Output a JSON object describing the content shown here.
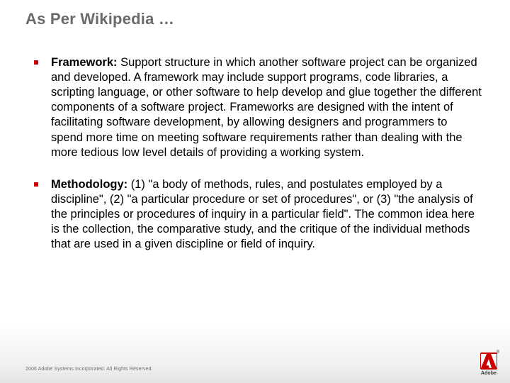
{
  "title": "As Per Wikipedia …",
  "bullets": [
    {
      "term": "Framework:",
      "body": " Support structure in which another software project can be organized and developed. A framework may include support programs, code libraries, a scripting language, or other software to help develop and glue together the different components of a software project. Frameworks are designed with the intent of facilitating software development, by allowing designers and programmers to spend more time on meeting software requirements rather than dealing with the more tedious low level details of providing a working system."
    },
    {
      "term": "Methodology:",
      "body": " (1) \"a body of methods, rules, and postulates employed by a discipline\", (2) \"a particular procedure or set of procedures\", or (3) \"the analysis of the principles or procedures of inquiry in a particular field\". The common idea here is the collection, the comparative study, and the critique of the individual methods that are used in a given discipline or field of inquiry."
    }
  ],
  "footer": "2006 Adobe Systems Incorporated. All Rights Reserved.",
  "logo": {
    "brand": "Adobe"
  }
}
